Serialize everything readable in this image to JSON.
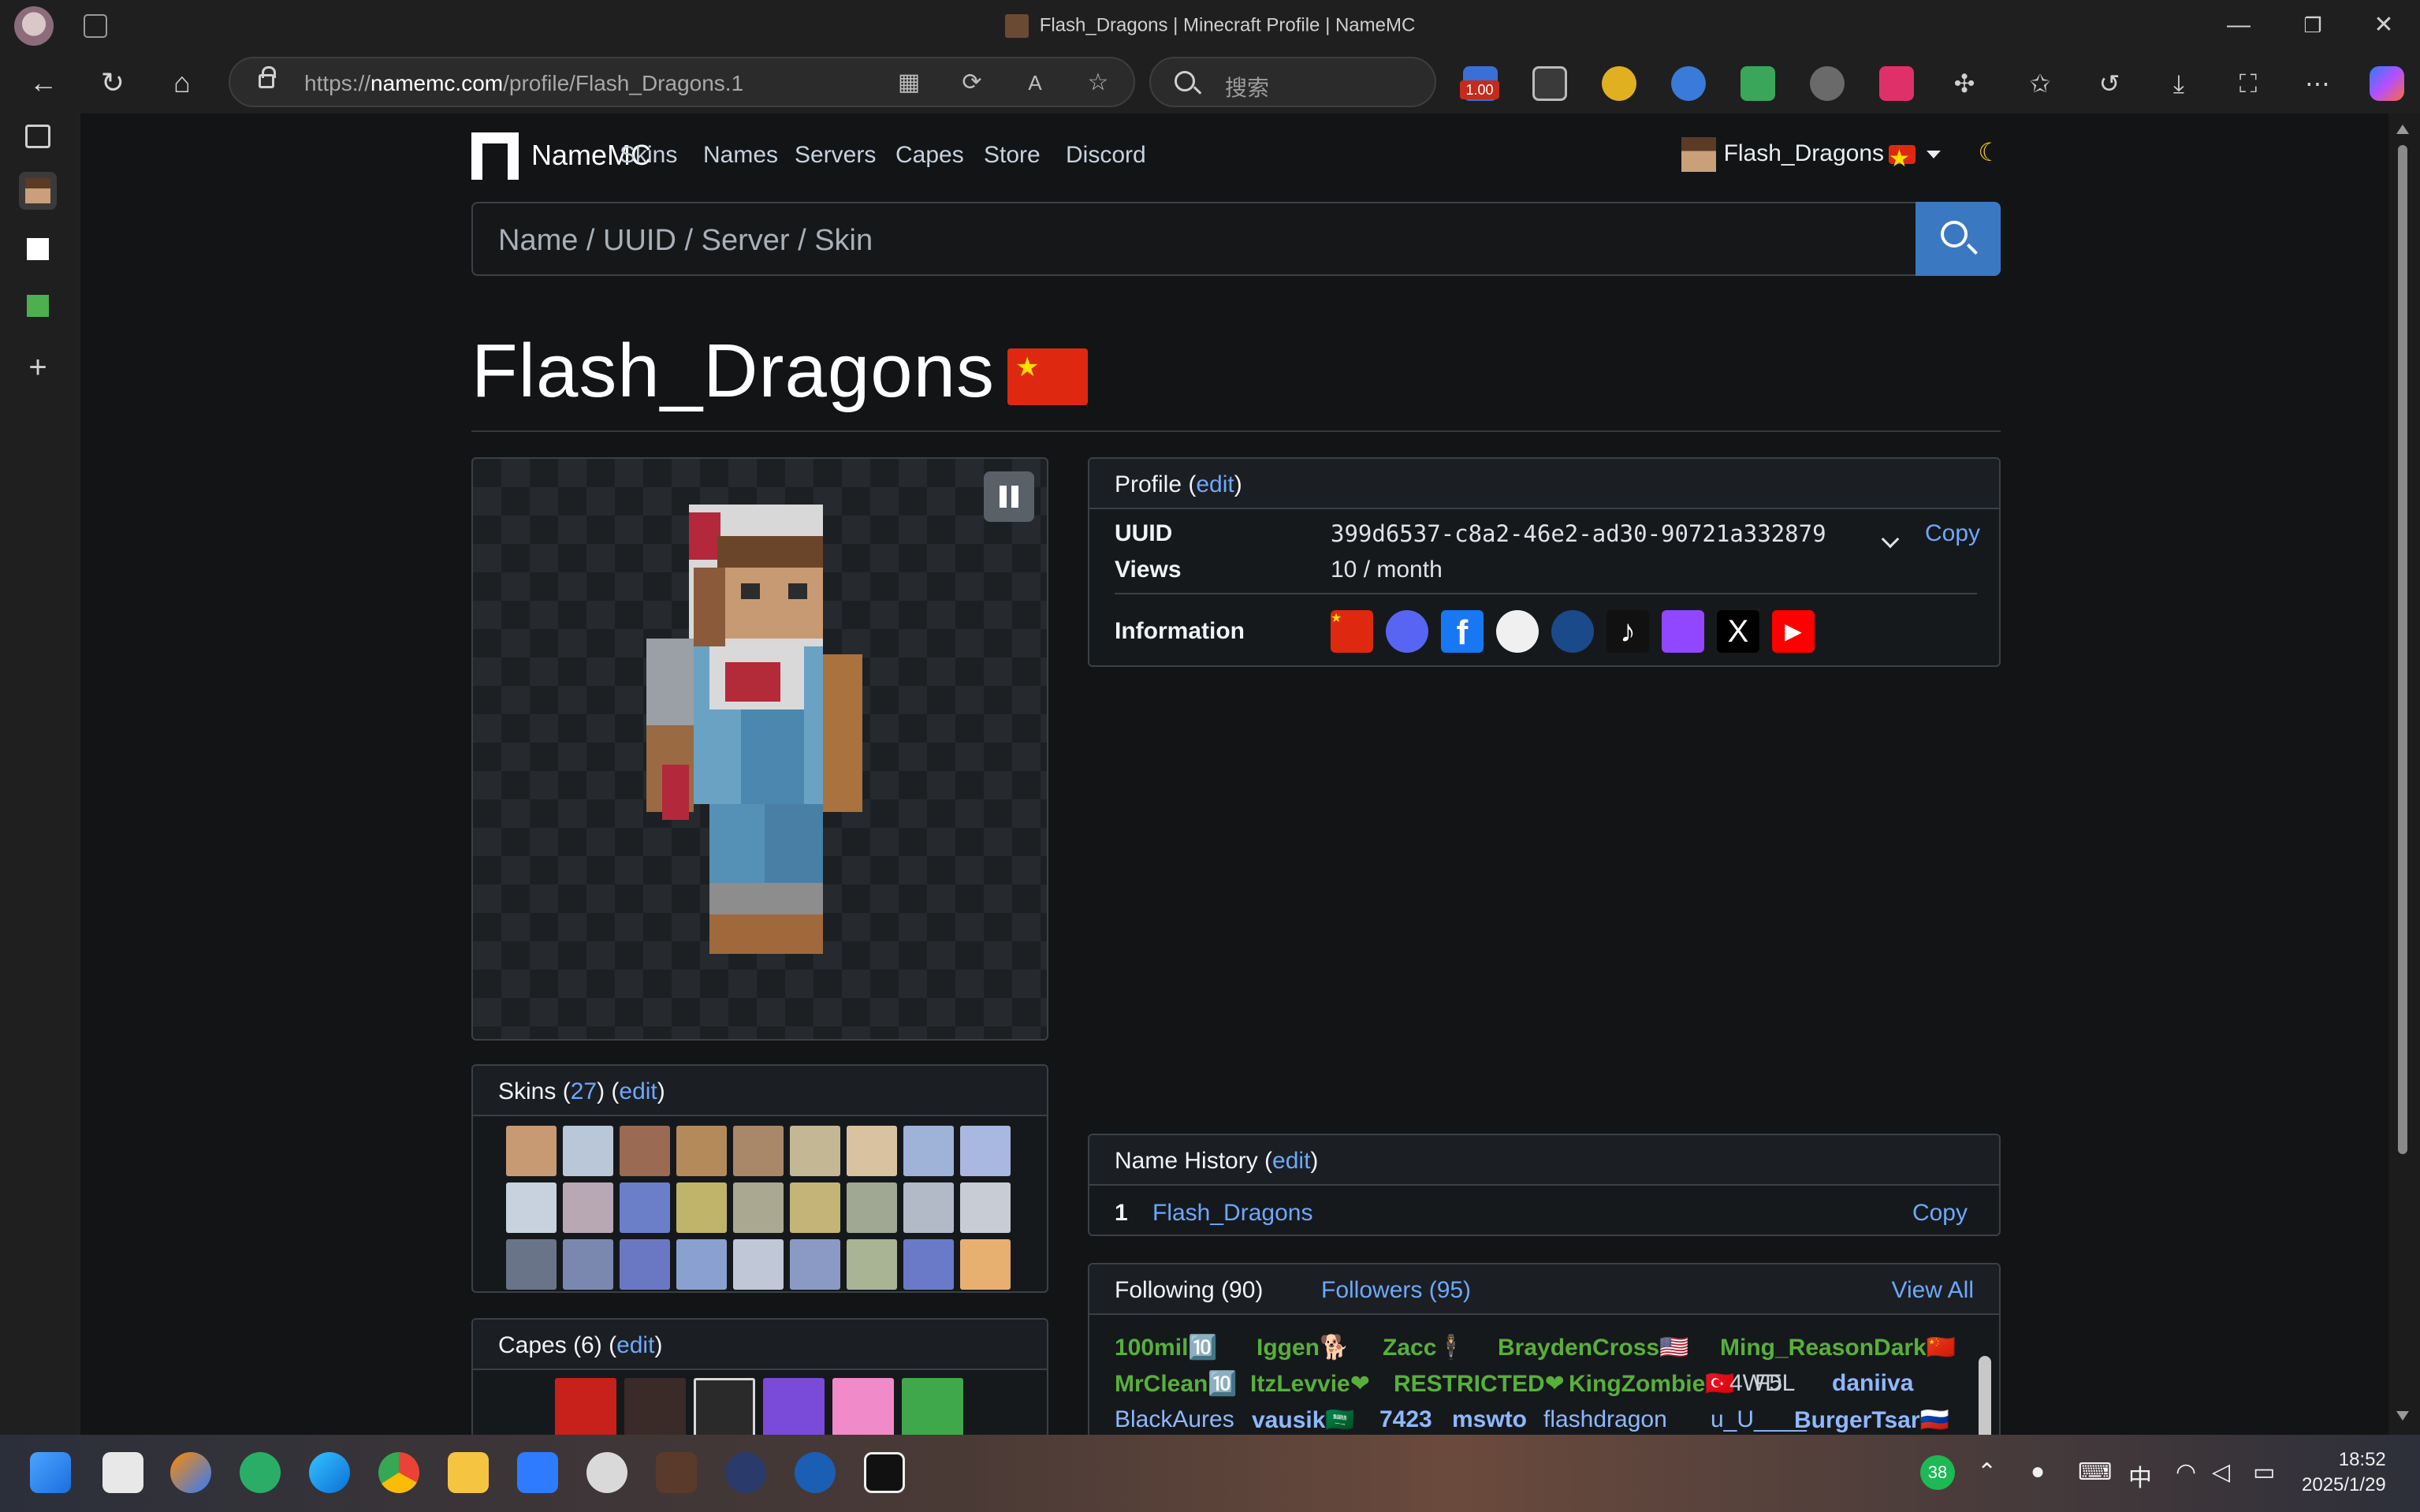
{
  "window": {
    "title": "Flash_Dragons | Minecraft Profile | NameMC",
    "minimize_glyph": "—",
    "restore_glyph": "❐",
    "close_glyph": "✕"
  },
  "browser": {
    "url_prefix": "https://",
    "url_host": "namemc.com",
    "url_path": "/profile/Flash_Dragons.1",
    "search_placeholder": "搜索",
    "extension_badge": "1.00",
    "back_glyph": "←",
    "reload_glyph": "↻",
    "home_glyph": "⌂",
    "more_glyph": "⋯"
  },
  "site": {
    "brand": "NameMC",
    "nav": [
      "Skins",
      "Names",
      "Servers",
      "Capes",
      "Store",
      "Discord"
    ],
    "user": "Flash_Dragons",
    "moon": "☾",
    "search_placeholder": "Name / UUID / Server / Skin"
  },
  "profile": {
    "name": "Flash_Dragons",
    "header": "Profile",
    "edit": "edit",
    "uuid_label": "UUID",
    "uuid": "399d6537-c8a2-46e2-ad30-90721a332879",
    "copy": "Copy",
    "views_label": "Views",
    "views": "10 / month",
    "info_label": "Information",
    "social_icons": [
      "china-flag-icon",
      "discord-icon",
      "facebook-icon",
      "github-icon",
      "steam-icon",
      "tiktok-icon",
      "twitch-icon",
      "x-icon",
      "youtube-icon"
    ]
  },
  "skins": {
    "label": "Skins",
    "count": "27",
    "edit": "edit"
  },
  "capes": {
    "label": "Capes",
    "count": "(6)",
    "edit": "edit"
  },
  "history": {
    "label": "Name History",
    "edit": "edit",
    "index": "1",
    "name": "Flash_Dragons",
    "copy": "Copy"
  },
  "social": {
    "following": "Following (90)",
    "followers": "Followers (95)",
    "view_all": "View All",
    "names": [
      {
        "t": "100mil",
        "suf": "🔟",
        "c": "#57b03a"
      },
      {
        "t": "Iggen",
        "suf": "🐕",
        "c": "#57b03a"
      },
      {
        "t": "Zacc",
        "suf": "🕴",
        "c": "#57b03a"
      },
      {
        "t": "BraydenCross",
        "suf": "🇺🇸",
        "c": "#57b03a"
      },
      {
        "t": "Ming_ReasonDark",
        "suf": "🇨🇳",
        "c": "#57b03a"
      },
      {
        "t": "MrClean",
        "suf": "🔟",
        "c": "#57b03a"
      },
      {
        "t": "ItzLevvie",
        "suf": "❤",
        "c": "#57b03a"
      },
      {
        "t": "RESTRICTED",
        "suf": "❤",
        "c": "#57b03a"
      },
      {
        "t": "KingZombie",
        "suf": "🇹🇷",
        "c": "#57b03a"
      },
      {
        "t": "4WDL",
        "suf": "",
        "c": "#c9d1d9"
      },
      {
        "t": "F5",
        "suf": "",
        "c": "#c9d1d9"
      },
      {
        "t": "daniiva",
        "suf": "",
        "c": "#8fb8ff"
      },
      {
        "t": "BlackAures",
        "suf": "",
        "c": "#8fb8ff"
      },
      {
        "t": "vausik",
        "suf": "🇸🇦",
        "c": "#8fb8ff"
      },
      {
        "t": "7423",
        "suf": "",
        "c": "#8fb8ff"
      },
      {
        "t": "mswto",
        "suf": "",
        "c": "#8fb8ff"
      },
      {
        "t": "flashdragon",
        "suf": "",
        "c": "#8fb8ff"
      },
      {
        "t": "u_U____",
        "suf": "",
        "c": "#8fb8ff"
      },
      {
        "t": "BurgerTsar",
        "suf": "🇷🇺",
        "c": "#8fb8ff"
      }
    ]
  },
  "taskbar": {
    "badge": "38",
    "ime": "中",
    "time": "18:52",
    "date": "2025/1/29"
  }
}
